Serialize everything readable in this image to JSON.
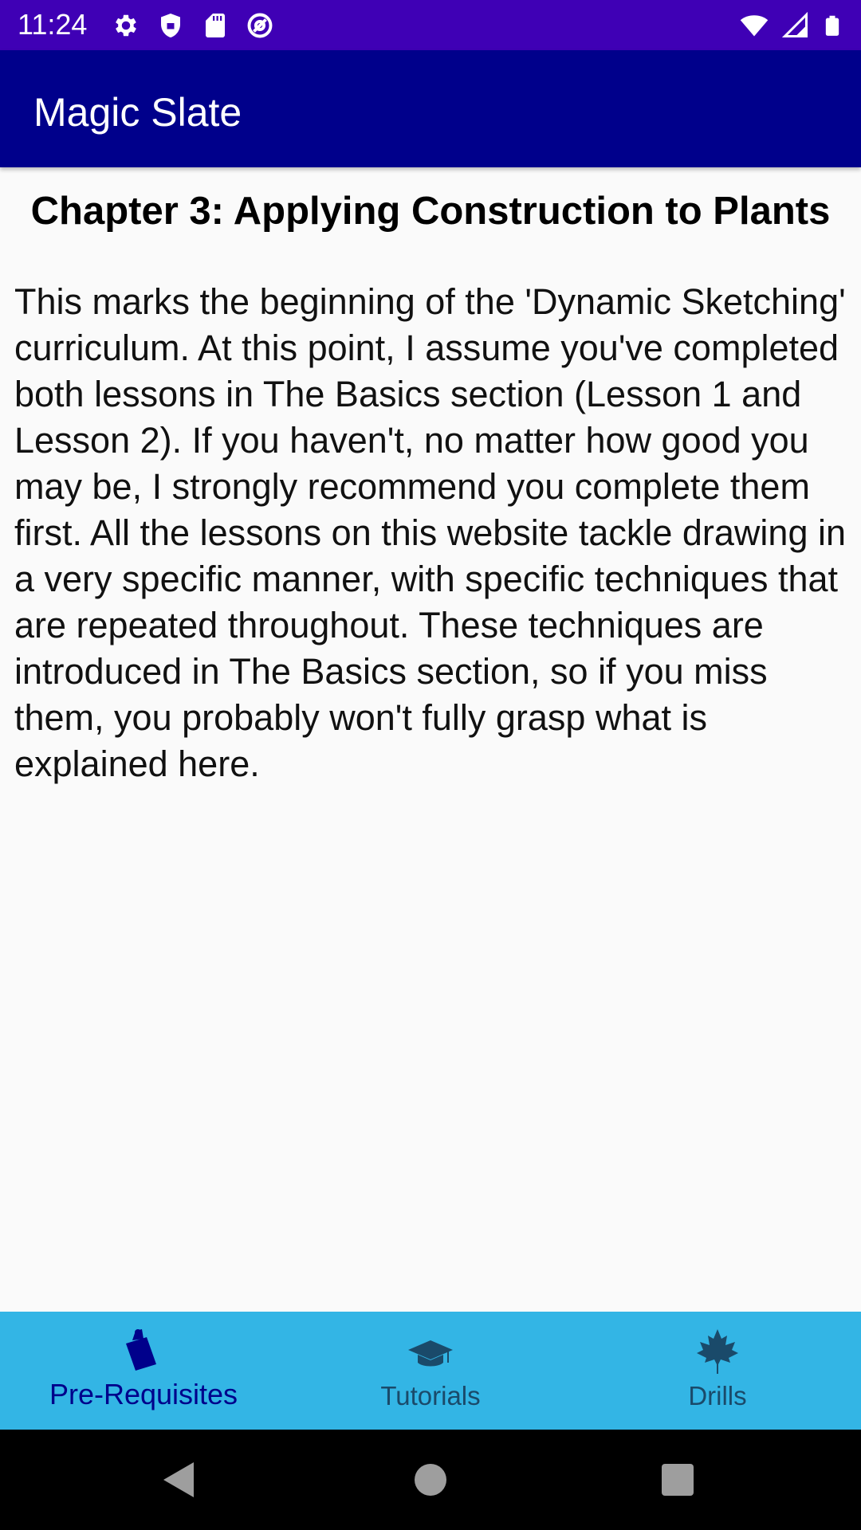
{
  "status_bar": {
    "time": "11:24",
    "left_icons": [
      "gear-icon",
      "shield-icon",
      "sd-card-icon",
      "at-sign-icon"
    ],
    "right_icons": [
      "wifi-icon",
      "signal-icon",
      "battery-icon"
    ]
  },
  "app_bar": {
    "title": "Magic Slate"
  },
  "content": {
    "chapter_title": "Chapter 3: Applying Construction to Plants",
    "chapter_body": "This marks the beginning of the 'Dynamic Sketching' curriculum. At this point, I assume you've completed both lessons in The Basics section (Lesson 1 and Lesson 2). If you haven't, no matter how good you may be, I strongly recommend you complete them first. All the lessons on this website tackle drawing in a very specific manner, with specific techniques that are repeated throughout. These techniques are introduced in The Basics section, so if you miss them, you probably won't fully grasp what is explained here."
  },
  "bottom_nav": {
    "items": [
      {
        "label": "Pre-Requisites",
        "icon": "clipboard-icon",
        "active": true
      },
      {
        "label": "Tutorials",
        "icon": "graduation-cap-icon",
        "active": false
      },
      {
        "label": "Drills",
        "icon": "maple-leaf-icon",
        "active": false
      }
    ]
  },
  "system_nav": {
    "buttons": [
      "back-icon",
      "home-icon",
      "recents-icon"
    ]
  },
  "colors": {
    "status_bar": "#3f00b5",
    "app_bar": "#00008b",
    "bottom_nav": "#33b5e5",
    "active_nav": "#00008b",
    "inactive_nav": "#1a4a6a"
  }
}
